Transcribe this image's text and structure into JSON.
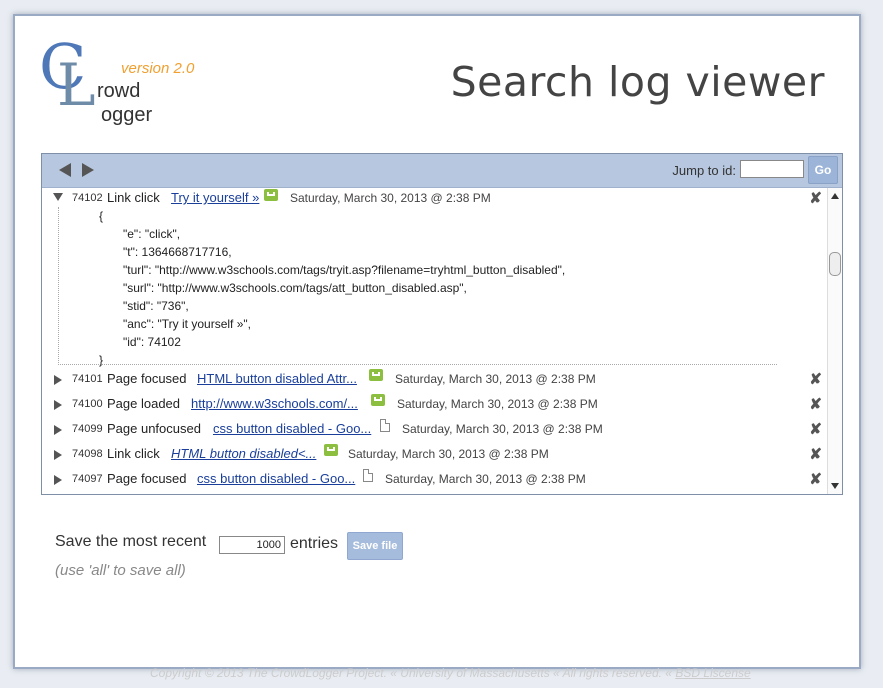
{
  "logo": {
    "c": "C",
    "l": "L",
    "rowd": "rowd",
    "ogger": "ogger",
    "version": "version 2.0"
  },
  "title": "Search log viewer",
  "toolbar": {
    "jump_label": "Jump to id:",
    "jump_value": "",
    "go_label": "Go"
  },
  "entries": [
    {
      "id": "74102",
      "type": "Link click",
      "link": "Try it yourself »",
      "icon": "green-icon",
      "date": "Saturday, March 30, 2013 @ 2:38 PM",
      "expanded": true,
      "json": [
        "{",
        "\"e\": \"click\",",
        "\"t\": 1364668717716,",
        "\"turl\": \"http://www.w3schools.com/tags/tryit.asp?filename=tryhtml_button_disabled\",",
        "\"surl\": \"http://www.w3schools.com/tags/att_button_disabled.asp\",",
        "\"stid\": \"736\",",
        "\"anc\": \"Try it yourself »\",",
        "\"id\": 74102",
        "}"
      ]
    },
    {
      "id": "74101",
      "type": "Page focused",
      "link": "HTML button disabled Attr...",
      "icon": "green-icon",
      "date": "Saturday, March 30, 2013 @ 2:38 PM"
    },
    {
      "id": "74100",
      "type": "Page loaded",
      "link": "http://www.w3schools.com/...",
      "icon": "green-icon",
      "date": "Saturday, March 30, 2013 @ 2:38 PM"
    },
    {
      "id": "74099",
      "type": "Page unfocused",
      "link": "css button disabled - Goo...",
      "icon": "doc-icon",
      "date": "Saturday, March 30, 2013 @ 2:38 PM"
    },
    {
      "id": "74098",
      "type": "Link click",
      "link": "HTML button disabled<...",
      "icon": "green-icon",
      "date": "Saturday, March 30, 2013 @ 2:38 PM"
    },
    {
      "id": "74097",
      "type": "Page focused",
      "link": "css button disabled - Goo...",
      "icon": "doc-icon",
      "date": "Saturday, March 30, 2013 @ 2:38 PM"
    }
  ],
  "save": {
    "prefix": "Save the most recent",
    "value": "1000",
    "suffix": "entries",
    "button": "Save file",
    "hint": "(use 'all' to save all)"
  },
  "footer": {
    "text": "Copyright © 2013 The CrowdLogger Project. « University of Massachusetts « All rights reserved. «",
    "link": "BSD Liscense"
  },
  "colors": {
    "accent": "#b7c7df",
    "link": "#1a3f9a",
    "green_icon": "#8cbf3f",
    "version": "#f0a030"
  }
}
